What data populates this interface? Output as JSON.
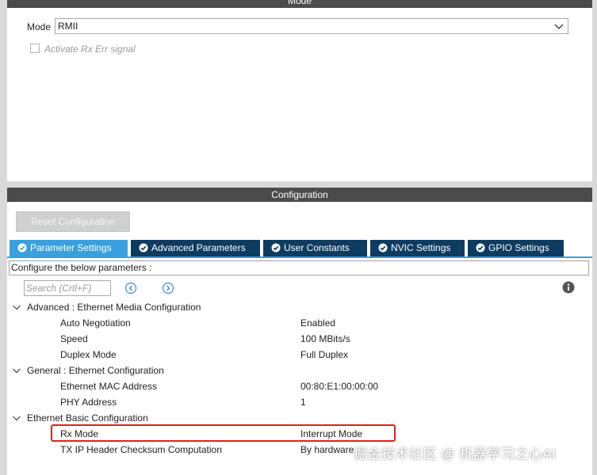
{
  "mode_panel": {
    "title": "Mode",
    "mode_label": "Mode",
    "mode_value": "RMII",
    "rx_err_label": "Activate Rx Err signal"
  },
  "config_panel": {
    "title": "Configuration",
    "reset_label": "Reset Configuration",
    "tabs": [
      {
        "label": "Parameter Settings",
        "active": true
      },
      {
        "label": "Advanced Parameters",
        "active": false
      },
      {
        "label": "User Constants",
        "active": false
      },
      {
        "label": "NVIC Settings",
        "active": false
      },
      {
        "label": "GPIO Settings",
        "active": false
      }
    ],
    "description": "Configure the below parameters :",
    "search_placeholder": "Search (Crtl+F)",
    "groups": [
      {
        "label": "Advanced : Ethernet Media Configuration",
        "params": [
          {
            "name": "Auto Negotiation",
            "value": "Enabled"
          },
          {
            "name": "Speed",
            "value": "100 MBits/s"
          },
          {
            "name": "Duplex Mode",
            "value": "Full Duplex"
          }
        ]
      },
      {
        "label": "General : Ethernet Configuration",
        "params": [
          {
            "name": "Ethernet MAC Address",
            "value": "00:80:E1:00:00:00"
          },
          {
            "name": "PHY Address",
            "value": "1"
          }
        ]
      },
      {
        "label": "Ethernet Basic Configuration",
        "params": [
          {
            "name": "Rx Mode",
            "value": "Interrupt Mode"
          },
          {
            "name": "TX IP Header Checksum Computation",
            "value": "By hardware"
          }
        ]
      }
    ]
  },
  "watermark": "掘金技术社区 @ 机器学习之心AI",
  "colors": {
    "header_bg": "#4b4b4b",
    "tab_active": "#39a0dd",
    "tab_inactive": "#0e3c60",
    "highlight": "#e02020"
  }
}
